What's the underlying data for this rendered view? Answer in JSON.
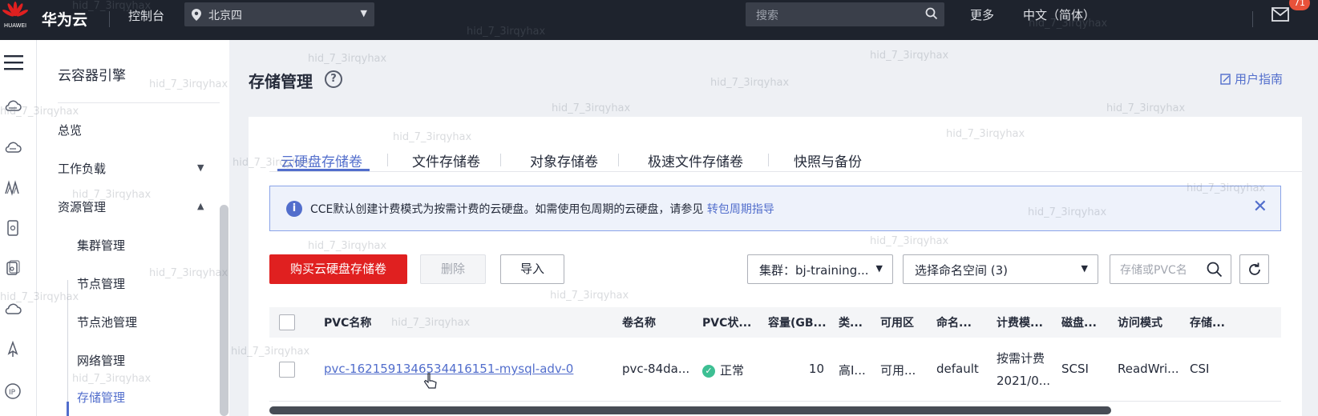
{
  "topbar": {
    "logo_text": "HUAWEI",
    "brand": "华为云",
    "console": "控制台",
    "region": "北京四",
    "search_placeholder": "搜索",
    "more": "更多",
    "language": "中文（简体）",
    "mail_badge": "71"
  },
  "sidebar": {
    "title": "云容器引擎",
    "items": {
      "overview": "总览",
      "workload": "工作负载",
      "resource": "资源管理",
      "cluster": "集群管理",
      "node": "节点管理",
      "nodepool": "节点池管理",
      "network": "网络管理",
      "storage": "存储管理"
    }
  },
  "page": {
    "title": "存储管理",
    "guide": "用户指南"
  },
  "tabs": [
    "云硬盘存储卷",
    "文件存储卷",
    "对象存储卷",
    "极速文件存储卷",
    "快照与备份"
  ],
  "notice": {
    "text": "CCE默认创建计费模式为按需计费的云硬盘。如需使用包周期的云硬盘，请参见",
    "link": "转包周期指导"
  },
  "toolbar": {
    "buy": "购买云硬盘存储卷",
    "delete": "删除",
    "import": "导入",
    "cluster_select": "集群：bj-training...",
    "namespace_select": "选择命名空间 (3)",
    "search_placeholder": "存储或PVC名"
  },
  "table": {
    "headers": [
      "PVC名称",
      "卷名称",
      "PVC状...",
      "容量(GB...",
      "类...",
      "可用区",
      "命名...",
      "计费模...",
      "磁盘...",
      "访问模式",
      "存储..."
    ],
    "rows": [
      {
        "pvc": "pvc-1621591346534416151-mysql-adv-0",
        "volume": "pvc-84da...",
        "status": "正常",
        "capacity": "10",
        "type": "高I...",
        "az": "可用...",
        "namespace": "default",
        "billing": "按需计费",
        "billing_date": "2021/0...",
        "disk": "SCSI",
        "access": "ReadWri...",
        "storage": "CSI"
      }
    ]
  },
  "watermark": "hid_7_3irqyhax",
  "colors": {
    "accent": "#526ecc",
    "buy": "#e02020",
    "topbar": "#1e232d",
    "ok": "#3dbf93"
  }
}
